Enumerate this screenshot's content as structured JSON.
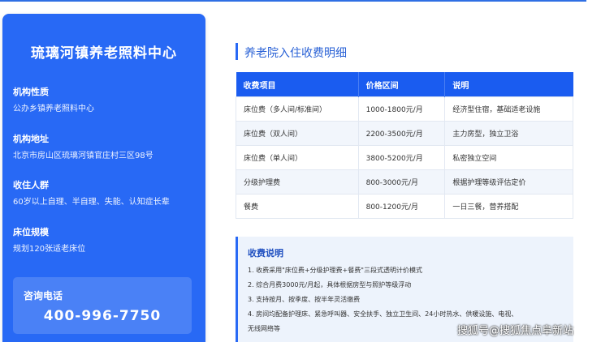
{
  "sidebar": {
    "org_name": "琉璃河镇养老照料中心",
    "items": [
      {
        "label": "机构性质",
        "value": "公办乡镇养老照料中心"
      },
      {
        "label": "机构地址",
        "value": "北京市房山区琉璃河镇官庄村三区98号"
      },
      {
        "label": "收住人群",
        "value": "60岁以上自理、半自理、失能、认知症长辈"
      },
      {
        "label": "床位规模",
        "value": "规划120张适老床位"
      }
    ],
    "phone_label": "咨询电话",
    "phone_number": "400-996-7750"
  },
  "main": {
    "section_title": "养老院入住收费明细",
    "table": {
      "headers": [
        "收费项目",
        "价格区间",
        "说明"
      ],
      "rows": [
        [
          "床位费（多人间/标准间）",
          "1000-1800元/月",
          "经济型住宿，基础适老设施"
        ],
        [
          "床位费（双人间）",
          "2200-3500元/月",
          "主力房型，独立卫浴"
        ],
        [
          "床位费（单人间）",
          "3800-5200元/月",
          "私密独立空间"
        ],
        [
          "分级护理费",
          "800-3000元/月",
          "根据护理等级评估定价"
        ],
        [
          "餐费",
          "800-1200元/月",
          "一日三餐，营养搭配"
        ]
      ]
    },
    "notes": {
      "title": "收费说明",
      "lines": [
        "1. 收费采用\"床位费+分级护理费+餐费\"三段式透明计价模式",
        "2. 综合月费3000元/月起，具体根据房型与照护等级浮动",
        "3. 支持按月、按季度、按半年灵活缴费",
        "4. 房间均配备护理床、紧急呼叫器、安全扶手、独立卫生间、24小时热水、供暖设施、电视、",
        "无线网络等"
      ]
    }
  },
  "watermark": "搜狐号@搜狐焦点阜新站"
}
